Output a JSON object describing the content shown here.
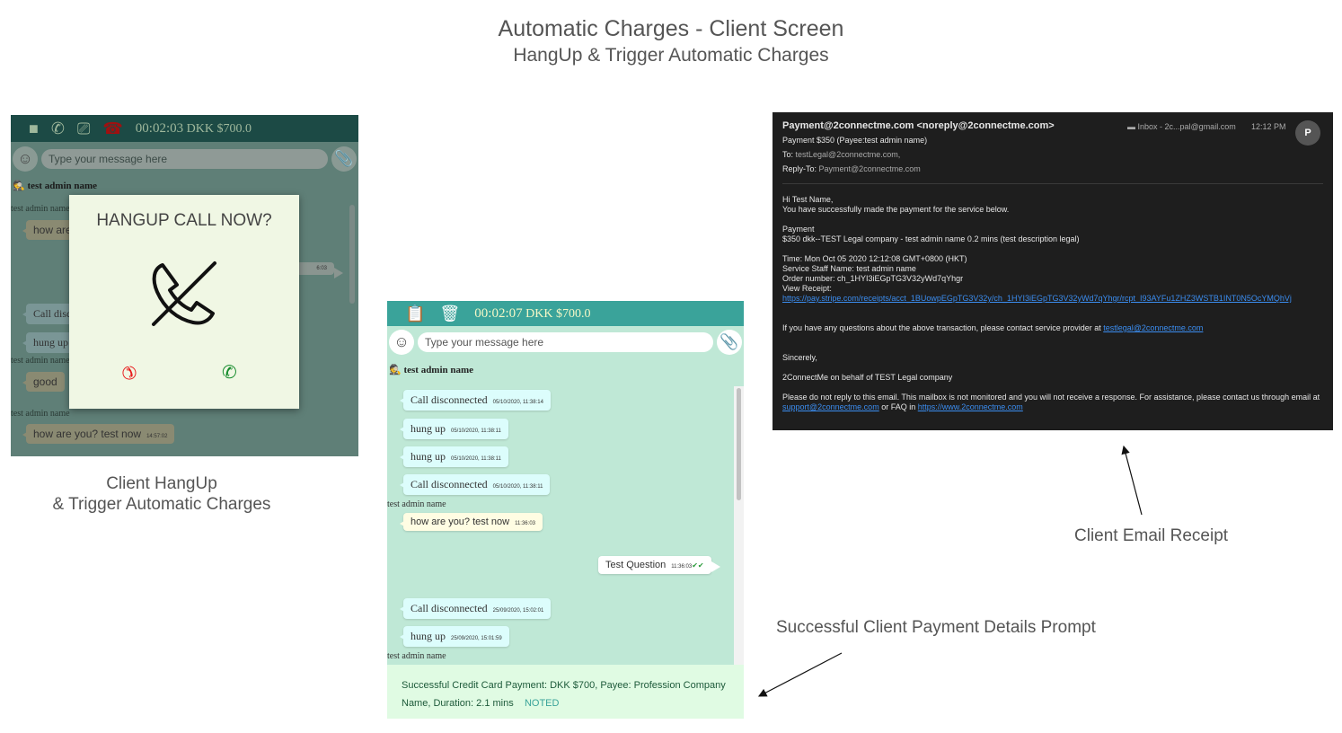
{
  "title": "Automatic Charges - Client Screen",
  "subtitle": "HangUp & Trigger Automatic Charges",
  "left_caption": [
    "Client HangUp",
    "& Trigger Automatic Charges"
  ],
  "right_caption": "Client Email Receipt",
  "middle_caption": "Successful Client Payment Details Prompt",
  "left": {
    "timer": "00:02:03",
    "amount": "DKK $700.0",
    "placeholder": "Type your message here",
    "contact": "test admin name",
    "labels": [
      "test admin name",
      "test admin name",
      "test admin name"
    ],
    "messages": [
      "how are",
      "Call disc",
      "hung up",
      "good",
      "how are you? test now"
    ],
    "times": {
      "last": "14:57:02",
      "right": "6:03"
    },
    "modal_title": "HANGUP CALL NOW?"
  },
  "middle": {
    "timer": "00:02:07",
    "amount": "DKK $700.0",
    "placeholder": "Type your message here",
    "contact": "test admin name",
    "messages": [
      {
        "text": "Call disconnected",
        "time": "05/10/2020, 11:38:14"
      },
      {
        "text": "hung up",
        "time": "05/10/2020, 11:38:11"
      },
      {
        "text": "hung up",
        "time": "05/10/2020, 11:38:11"
      },
      {
        "text": "Call disconnected",
        "time": "05/10/2020, 11:38:11"
      },
      {
        "text": "how are you? test now",
        "time": "11:36:03"
      },
      {
        "text": "Test Question",
        "time": "11:36:03"
      },
      {
        "text": "Call disconnected",
        "time": "25/09/2020, 15:02:01"
      },
      {
        "text": "hung up",
        "time": "25/09/2020, 15:01:59"
      }
    ],
    "sender_label": "test admin name",
    "prompt": "Successful Credit Card Payment: DKK $700, Payee: Profession Company Name, Duration: 2.1 mins",
    "noted": "NOTED"
  },
  "email": {
    "from": "Payment@2connectme.com <noreply@2connectme.com>",
    "subject": "Payment $350 (Payee:test admin name)",
    "to_label": "To:",
    "to": "testLegal@2connectme.com,",
    "reply_label": "Reply-To:",
    "reply": "Payment@2connectme.com",
    "mailbox": "Inbox - 2c...pal@gmail.com",
    "time": "12:12 PM",
    "avatar": "P",
    "greeting": "Hi Test Name,",
    "line1": "You have successfully made the payment for the service below.",
    "payment_h": "Payment",
    "payment": "$350 dkk--TEST Legal company - test admin name 0.2 mins (test description legal)",
    "time_line": "Time: Mon Oct 05 2020 12:12:08 GMT+0800 (HKT)",
    "staff": "Service Staff Name: test admin name",
    "order": "Order number: ch_1HYI3iEGpTG3V32yWd7qYhgr",
    "view": "View Receipt:",
    "receipt_url": "https://pay.stripe.com/receipts/acct_1BUowpEGpTG3V32y/ch_1HYI3iEGpTG3V32yWd7qYhgr/rcpt_I93AYFu1ZHZ3WSTB1INT0N5OcYMQhVj",
    "questions": "If you have any questions about the above transaction, please contact service provider at",
    "provider_email": "testlegal@2connectme.com",
    "sincerely": "Sincerely,",
    "behalf": "2ConnectMe on behalf of TEST Legal company",
    "noreply": "Please do not reply to this email. This mailbox is not monitored and you will not receive a response. For assistance, please contact us through email at",
    "support": "support@2connectme.com",
    "faq": "or FAQ in",
    "site": "https://www.2connectme.com"
  },
  "colors": {
    "left_header": "#1c4a45",
    "mid_header": "#3aa39a",
    "mid_bg": "#bfe8d6",
    "prompt_bg": "#e0fbe3",
    "email_bg": "#1e1e1e",
    "link": "#3b8df0",
    "hangup_red": "#e81c1c",
    "call_green": "#138a2a"
  }
}
